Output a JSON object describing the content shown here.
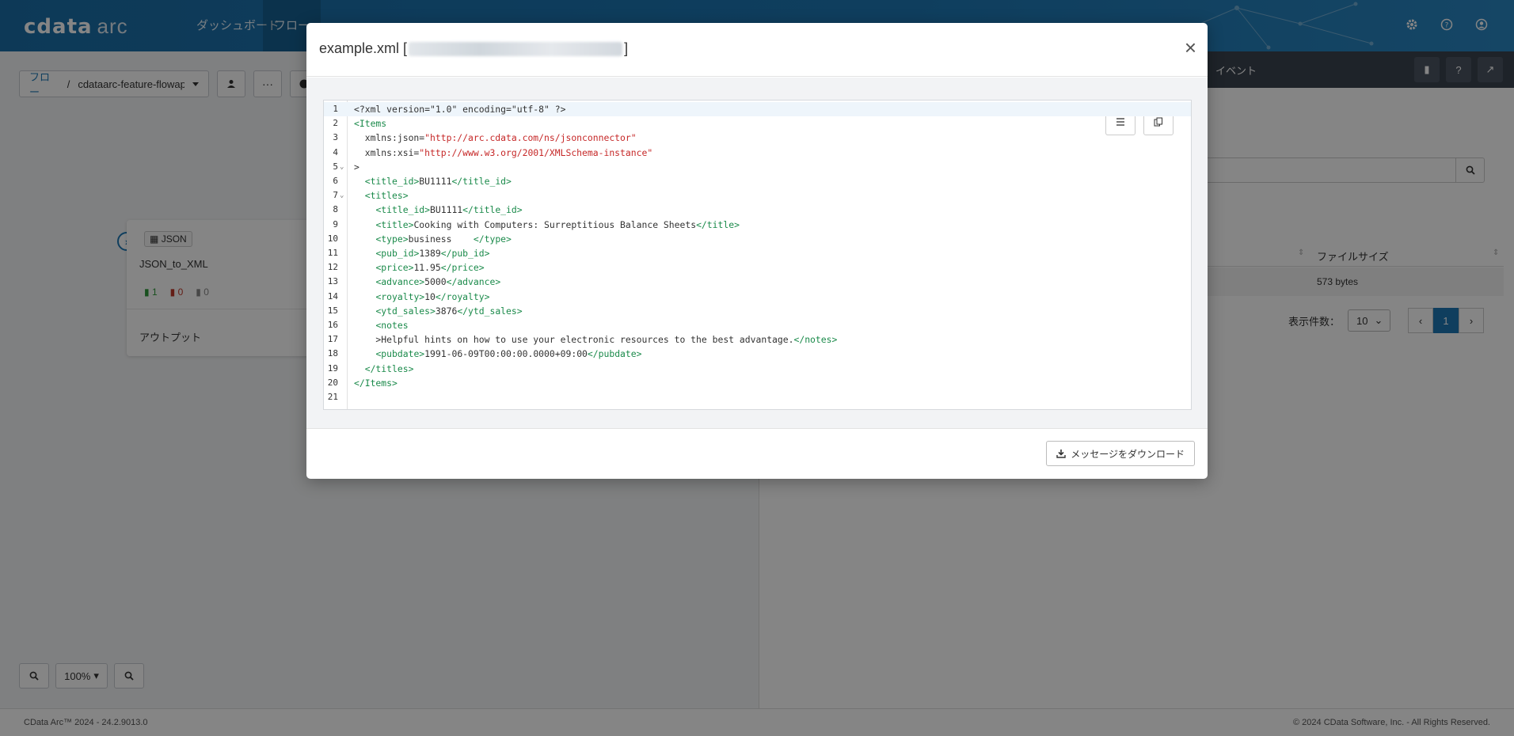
{
  "app": {
    "logo_brand": "cdata",
    "logo_product": "arc",
    "nav": [
      "ダッシュボード",
      "フロー"
    ]
  },
  "toolbar": {
    "breadcrumb_root": "フロー",
    "breadcrumb_sep": "/",
    "breadcrumb_current": "cdataarc-feature-flowapi",
    "more_label": "···"
  },
  "node": {
    "tag": "JSON",
    "title": "JSON_to_XML",
    "success_count": "1",
    "error_count": "0",
    "pending_count": "0",
    "output_label": "アウトプット"
  },
  "right_pane": {
    "tab_events": "イベント",
    "col_filesize": "ファイルサイズ",
    "row_filesize": "573 bytes",
    "page_size_label": "表示件数：",
    "page_size_value": "10",
    "current_page": "1"
  },
  "zoom": {
    "level": "100%"
  },
  "footer": {
    "version": "CData Arc™ 2024 - 24.2.9013.0",
    "copyright": "© 2024 CData Software, Inc. - All Rights Reserved."
  },
  "modal": {
    "title": "example.xml",
    "bracket_open": "[",
    "bracket_close": "]",
    "download_label": "メッセージをダウンロード",
    "lines": [
      {
        "n": "1",
        "fold": false,
        "parts": [
          [
            "t",
            "<?xml version=\"1.0\" encoding=\"utf-8\" ?>"
          ]
        ]
      },
      {
        "n": "2",
        "fold": false,
        "parts": [
          [
            "g",
            "<Items"
          ]
        ]
      },
      {
        "n": "3",
        "fold": false,
        "parts": [
          [
            "t",
            "  xmlns:json="
          ],
          [
            "s",
            "\"http://arc.cdata.com/ns/jsonconnector\""
          ]
        ]
      },
      {
        "n": "4",
        "fold": false,
        "parts": [
          [
            "t",
            "  xmlns:xsi="
          ],
          [
            "s",
            "\"http://www.w3.org/2001/XMLSchema-instance\""
          ]
        ]
      },
      {
        "n": "5",
        "fold": true,
        "parts": [
          [
            "t",
            ">"
          ]
        ]
      },
      {
        "n": "6",
        "fold": false,
        "parts": [
          [
            "t",
            "  "
          ],
          [
            "g",
            "<title_id>"
          ],
          [
            "t",
            "BU1111"
          ],
          [
            "g",
            "</title_id>"
          ]
        ]
      },
      {
        "n": "7",
        "fold": true,
        "parts": [
          [
            "t",
            "  "
          ],
          [
            "g",
            "<titles>"
          ]
        ]
      },
      {
        "n": "8",
        "fold": false,
        "parts": [
          [
            "t",
            "    "
          ],
          [
            "g",
            "<title_id>"
          ],
          [
            "t",
            "BU1111"
          ],
          [
            "g",
            "</title_id>"
          ]
        ]
      },
      {
        "n": "9",
        "fold": false,
        "parts": [
          [
            "t",
            "    "
          ],
          [
            "g",
            "<title>"
          ],
          [
            "t",
            "Cooking with Computers: Surreptitious Balance Sheets"
          ],
          [
            "g",
            "</title>"
          ]
        ]
      },
      {
        "n": "10",
        "fold": false,
        "parts": [
          [
            "t",
            "    "
          ],
          [
            "g",
            "<type>"
          ],
          [
            "t",
            "business    "
          ],
          [
            "g",
            "</type>"
          ]
        ]
      },
      {
        "n": "11",
        "fold": false,
        "parts": [
          [
            "t",
            "    "
          ],
          [
            "g",
            "<pub_id>"
          ],
          [
            "t",
            "1389"
          ],
          [
            "g",
            "</pub_id>"
          ]
        ]
      },
      {
        "n": "12",
        "fold": false,
        "parts": [
          [
            "t",
            "    "
          ],
          [
            "g",
            "<price>"
          ],
          [
            "t",
            "11.95"
          ],
          [
            "g",
            "</price>"
          ]
        ]
      },
      {
        "n": "13",
        "fold": false,
        "parts": [
          [
            "t",
            "    "
          ],
          [
            "g",
            "<advance>"
          ],
          [
            "t",
            "5000"
          ],
          [
            "g",
            "</advance>"
          ]
        ]
      },
      {
        "n": "14",
        "fold": false,
        "parts": [
          [
            "t",
            "    "
          ],
          [
            "g",
            "<royalty>"
          ],
          [
            "t",
            "10"
          ],
          [
            "g",
            "</royalty>"
          ]
        ]
      },
      {
        "n": "15",
        "fold": false,
        "parts": [
          [
            "t",
            "    "
          ],
          [
            "g",
            "<ytd_sales>"
          ],
          [
            "t",
            "3876"
          ],
          [
            "g",
            "</ytd_sales>"
          ]
        ]
      },
      {
        "n": "16",
        "fold": false,
        "parts": [
          [
            "t",
            "    "
          ],
          [
            "g",
            "<notes"
          ]
        ]
      },
      {
        "n": "17",
        "fold": false,
        "parts": [
          [
            "t",
            "    >Helpful hints on how to use your electronic resources to the best advantage."
          ],
          [
            "g",
            "</notes>"
          ]
        ]
      },
      {
        "n": "18",
        "fold": false,
        "parts": [
          [
            "t",
            "    "
          ],
          [
            "g",
            "<pubdate>"
          ],
          [
            "t",
            "1991-06-09T00:00:00.0000+09:00"
          ],
          [
            "g",
            "</pubdate>"
          ]
        ]
      },
      {
        "n": "19",
        "fold": false,
        "parts": [
          [
            "t",
            "  "
          ],
          [
            "g",
            "</titles>"
          ]
        ]
      },
      {
        "n": "20",
        "fold": false,
        "parts": [
          [
            "g",
            "</Items>"
          ]
        ]
      },
      {
        "n": "21",
        "fold": false,
        "parts": []
      }
    ]
  },
  "icons": {
    "gear": "gear-icon",
    "help": "help-icon",
    "user": "user-icon",
    "close": "close-icon",
    "wrap": "wrap-lines-icon",
    "copy": "copy-icon",
    "download": "download-icon",
    "search": "search-icon"
  }
}
